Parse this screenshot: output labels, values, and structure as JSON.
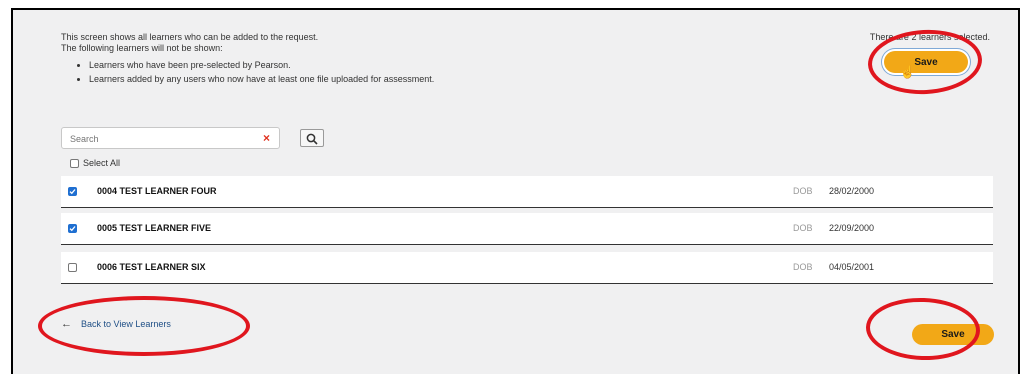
{
  "intro": {
    "line1": "This screen shows all learners who can be added to the request.",
    "line2": "The following learners will not be shown:",
    "bullets": [
      "Learners who have been pre-selected by Pearson.",
      "Learners added by any users who now have at least one file uploaded for assessment."
    ]
  },
  "selection_status": "There are 2 learners selected.",
  "save_label": "Save",
  "search": {
    "placeholder": "Search",
    "clear_glyph": "×",
    "value": ""
  },
  "select_all_label": "Select All",
  "learners": [
    {
      "name": "0004 TEST LEARNER FOUR",
      "checked": true,
      "dob_label": "DOB",
      "dob": "28/02/2000"
    },
    {
      "name": "0005 TEST LEARNER FIVE",
      "checked": true,
      "dob_label": "DOB",
      "dob": "22/09/2000"
    },
    {
      "name": "0006 TEST LEARNER SIX",
      "checked": false,
      "dob_label": "DOB",
      "dob": "04/05/2001"
    }
  ],
  "back_link": {
    "arrow": "←",
    "label": "Back to View Learners"
  },
  "icons": {
    "search": "search-icon",
    "back": "arrow-left-icon",
    "cursor": "hand-pointer-icon"
  },
  "colors": {
    "save_button": "#f2a817",
    "annotation_ring": "#e0161e",
    "checkbox_checked": "#1f6fd1",
    "link": "#1f4f86"
  }
}
